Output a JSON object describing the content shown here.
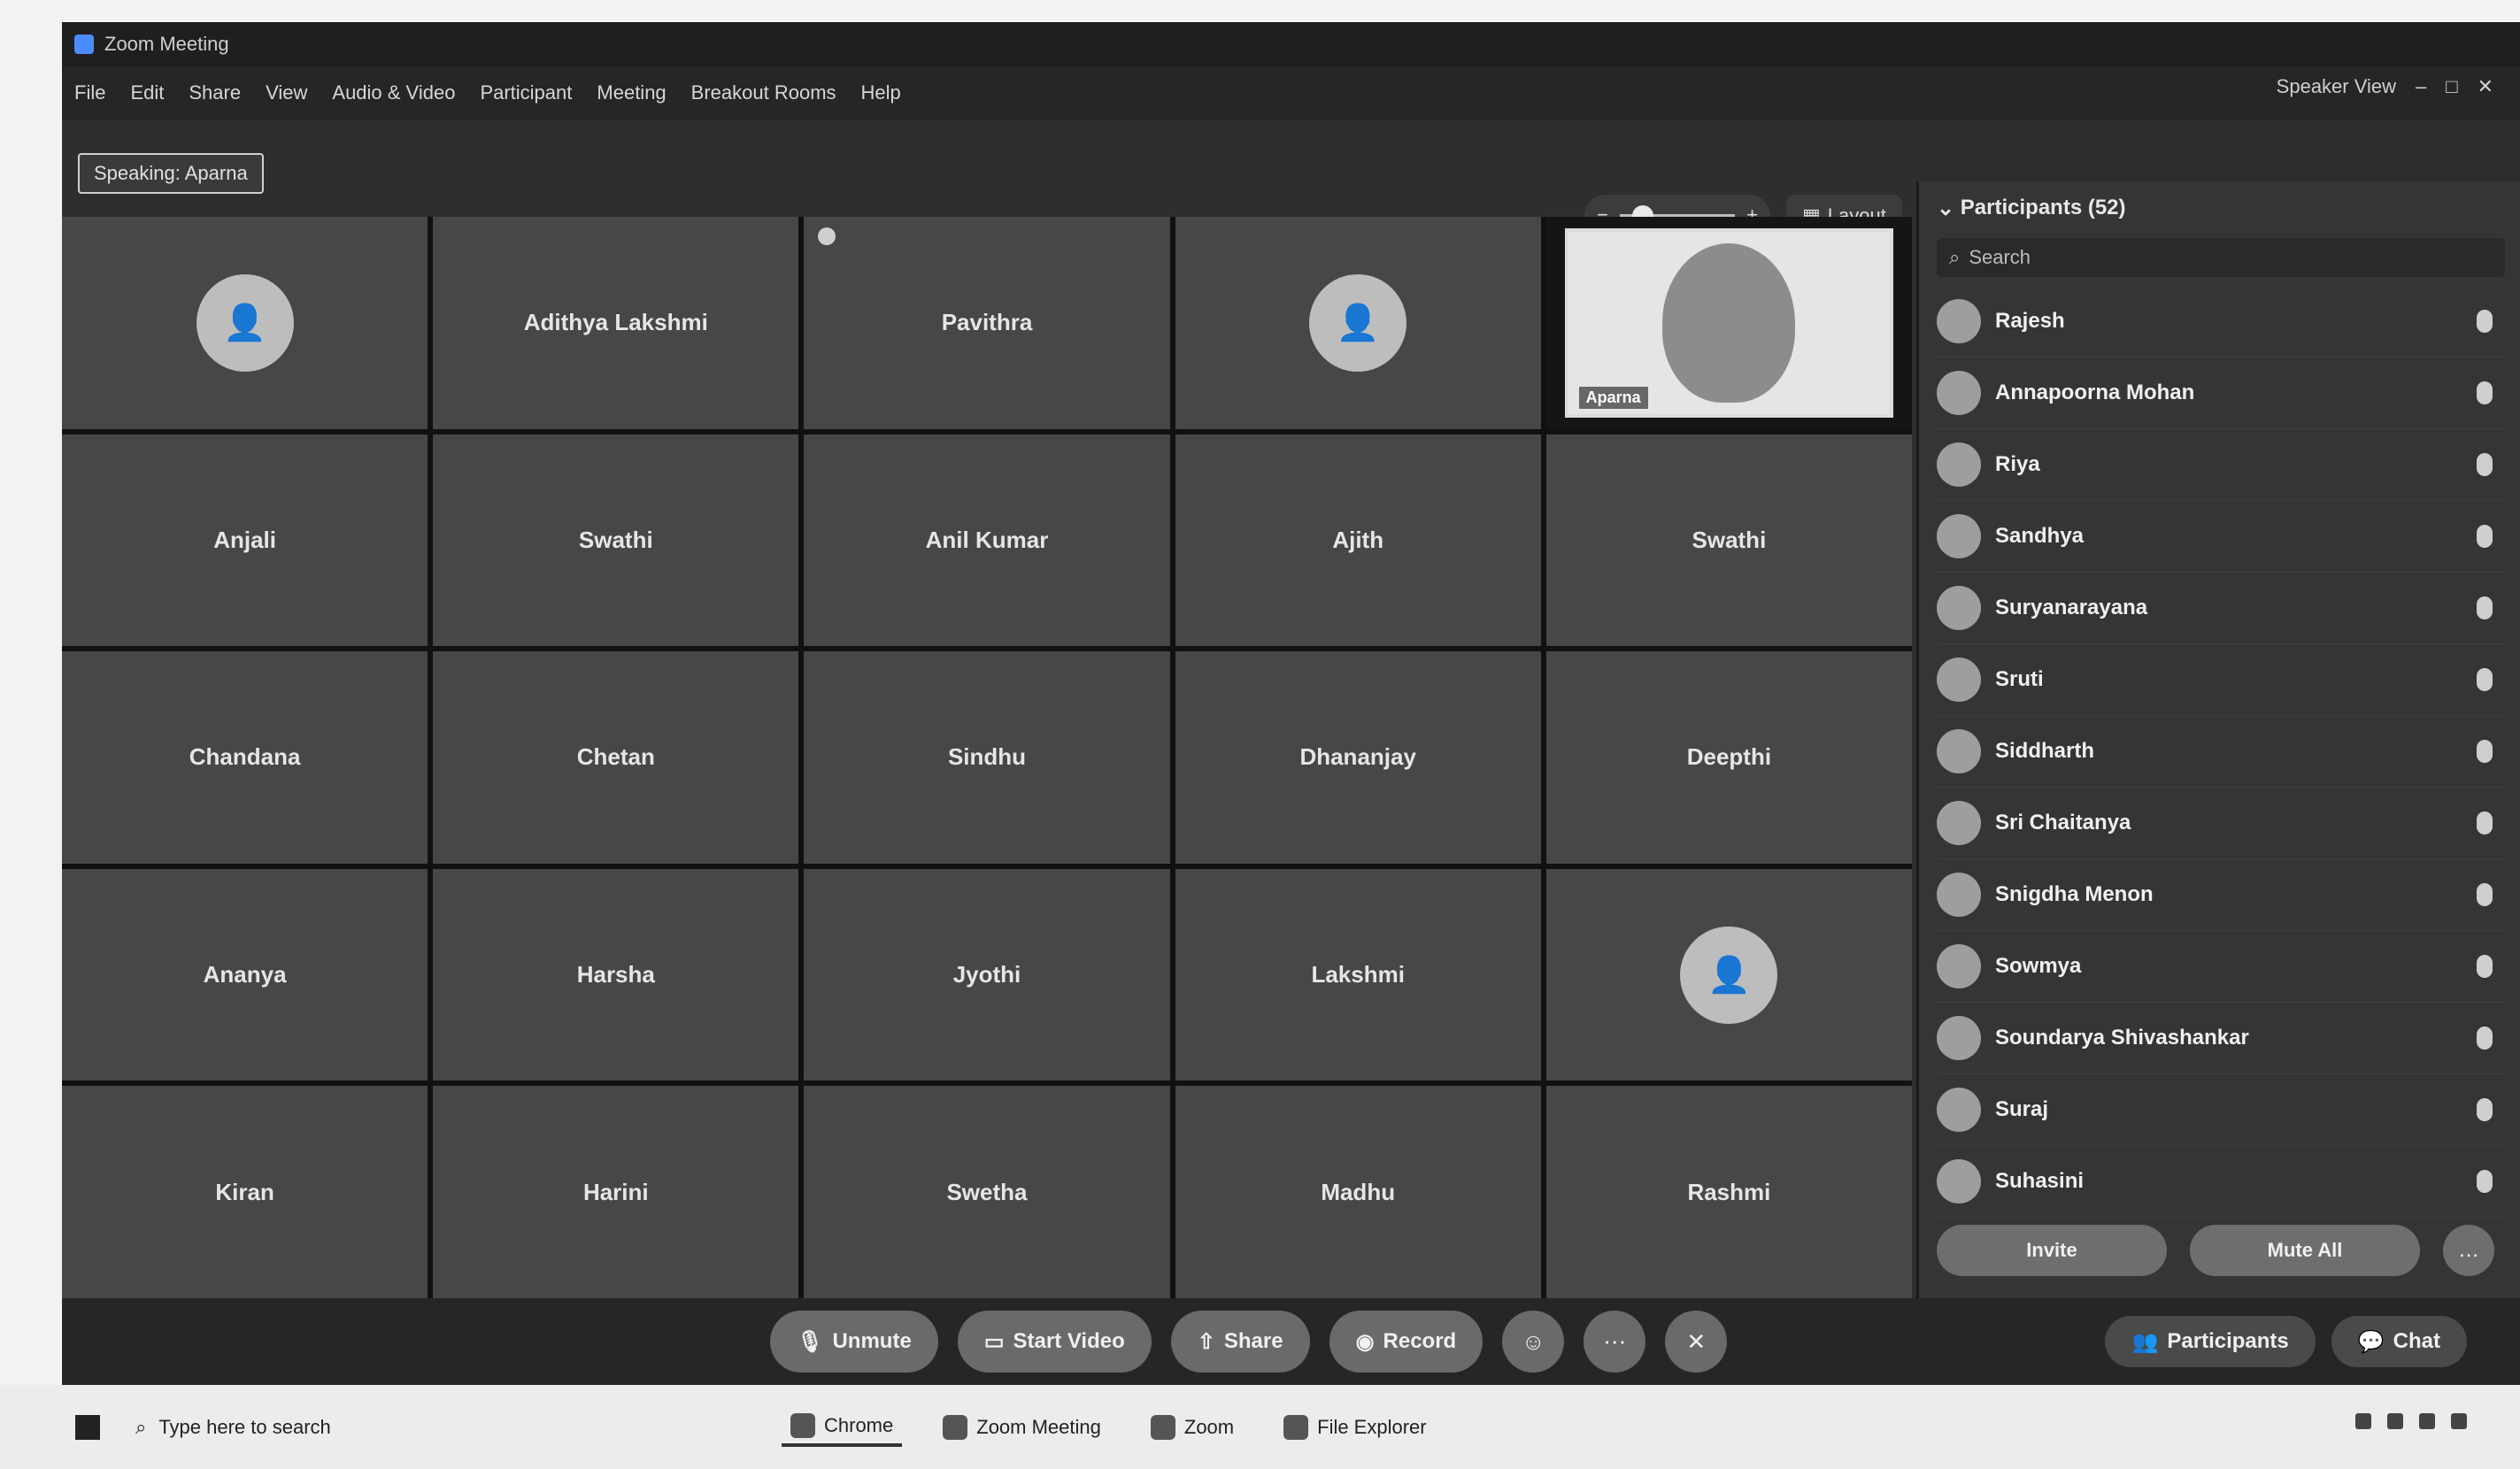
{
  "window": {
    "title": "Zoom Meeting"
  },
  "menubar": {
    "items": [
      "File",
      "Edit",
      "Share",
      "View",
      "Audio & Video",
      "Participant",
      "Meeting",
      "Breakout Rooms",
      "Help"
    ],
    "view_label": "Speaker View"
  },
  "speaking_indicator": "Speaking: Aparna",
  "toolbar": {
    "layout_label": "Layout"
  },
  "gallery": {
    "tiles": [
      {
        "name": "",
        "type": "avatar"
      },
      {
        "name": "Adithya Lakshmi",
        "type": "name"
      },
      {
        "name": "Pavithra",
        "type": "name"
      },
      {
        "name": "",
        "type": "avatar"
      },
      {
        "name": "Aparna",
        "type": "video"
      },
      {
        "name": "Anjali",
        "type": "name"
      },
      {
        "name": "Swathi",
        "type": "name"
      },
      {
        "name": "Anil Kumar",
        "type": "name"
      },
      {
        "name": "Ajith",
        "type": "name"
      },
      {
        "name": "Swathi",
        "type": "name"
      },
      {
        "name": "Chandana",
        "type": "name"
      },
      {
        "name": "Chetan",
        "type": "name"
      },
      {
        "name": "Sindhu",
        "type": "name"
      },
      {
        "name": "Dhananjay",
        "type": "name"
      },
      {
        "name": "Deepthi",
        "type": "name"
      },
      {
        "name": "Ananya",
        "type": "name"
      },
      {
        "name": "Harsha",
        "type": "name"
      },
      {
        "name": "Jyothi",
        "type": "name"
      },
      {
        "name": "Lakshmi",
        "type": "name"
      },
      {
        "name": "",
        "type": "avatar"
      },
      {
        "name": "Kiran",
        "type": "name"
      },
      {
        "name": "Harini",
        "type": "name"
      },
      {
        "name": "Swetha",
        "type": "name"
      },
      {
        "name": "Madhu",
        "type": "name"
      },
      {
        "name": "Rashmi",
        "type": "name"
      }
    ]
  },
  "participants": {
    "header": "Participants (52)",
    "search_placeholder": "Search",
    "list": [
      {
        "name": "Rajesh",
        "role": ""
      },
      {
        "name": "Annapoorna Mohan",
        "role": ""
      },
      {
        "name": "Riya",
        "role": ""
      },
      {
        "name": "Sandhya",
        "role": ""
      },
      {
        "name": "Suryanarayana",
        "role": ""
      },
      {
        "name": "Sruti",
        "role": ""
      },
      {
        "name": "Siddharth",
        "role": ""
      },
      {
        "name": "Sri Chaitanya",
        "role": ""
      },
      {
        "name": "Snigdha Menon",
        "role": ""
      },
      {
        "name": "Sowmya",
        "role": ""
      },
      {
        "name": "Soundarya Shivashankar",
        "role": ""
      },
      {
        "name": "Suraj",
        "role": ""
      },
      {
        "name": "Suhasini",
        "role": ""
      }
    ],
    "invite_label": "Invite",
    "mute_all_label": "Mute All",
    "more_label": "…"
  },
  "controls": {
    "unmute_label": "Unmute",
    "start_video_label": "Start Video",
    "share_label": "Share",
    "record_label": "Record",
    "participants_label": "Participants",
    "chat_label": "Chat"
  },
  "taskbar": {
    "search_placeholder": "Type here to search",
    "apps": [
      "Chrome",
      "Zoom Meeting",
      "Zoom",
      "File Explorer"
    ]
  }
}
